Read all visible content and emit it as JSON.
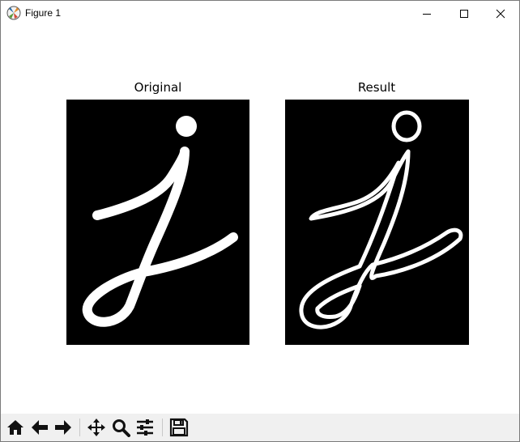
{
  "window": {
    "title": "Figure 1"
  },
  "figure": {
    "axes": [
      {
        "title": "Original"
      },
      {
        "title": "Result"
      }
    ]
  },
  "toolbar": {
    "buttons": [
      "home-icon",
      "back-icon",
      "forward-icon",
      "pan-icon",
      "zoom-icon",
      "configure-subplots-icon",
      "save-icon"
    ]
  }
}
